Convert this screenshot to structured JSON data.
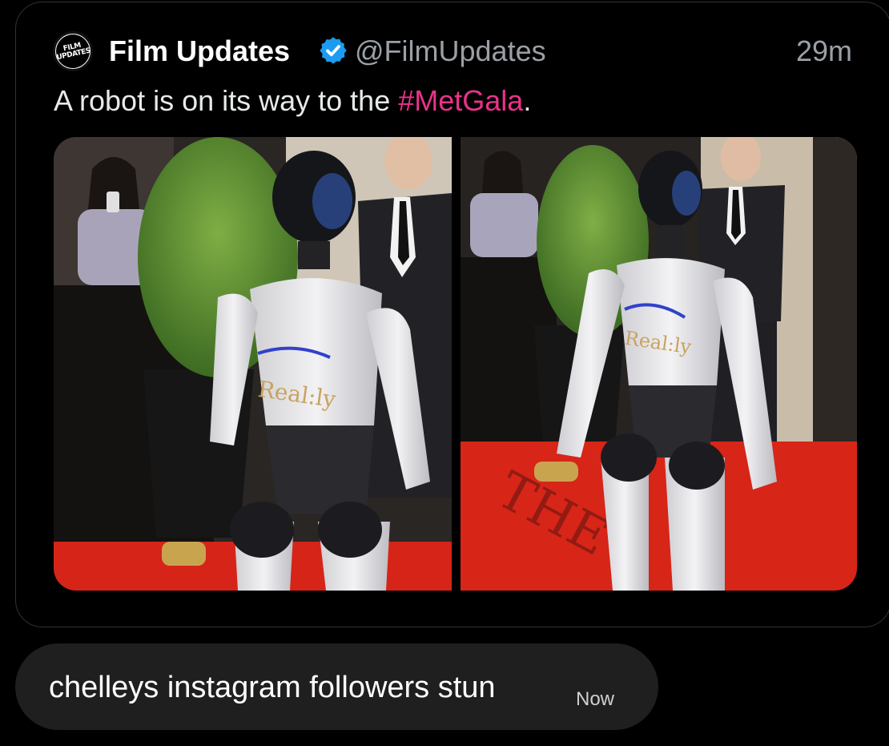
{
  "quoted_tweet": {
    "avatar_lines": [
      "FILM",
      "UPDATES"
    ],
    "display_name": "Film Updates",
    "verified_icon": "verified-badge-icon",
    "handle": "@FilmUpdates",
    "timestamp": "29m",
    "text_before": "A robot is on its way to the ",
    "hashtag": "#MetGala",
    "text_after": ".",
    "media": {
      "count": 2,
      "robot_chest_logo": "Real:ly",
      "floor_lettering": "THE"
    }
  },
  "reply": {
    "text": "chelleys instagram followers stun",
    "time": "Now"
  },
  "colors": {
    "background": "#000000",
    "bubble": "#1f1f1f",
    "hashtag": "#e8338a",
    "verified": "#1d9bf0",
    "secondary_text": "#9aa0a6",
    "card_border": "#2f3336"
  }
}
